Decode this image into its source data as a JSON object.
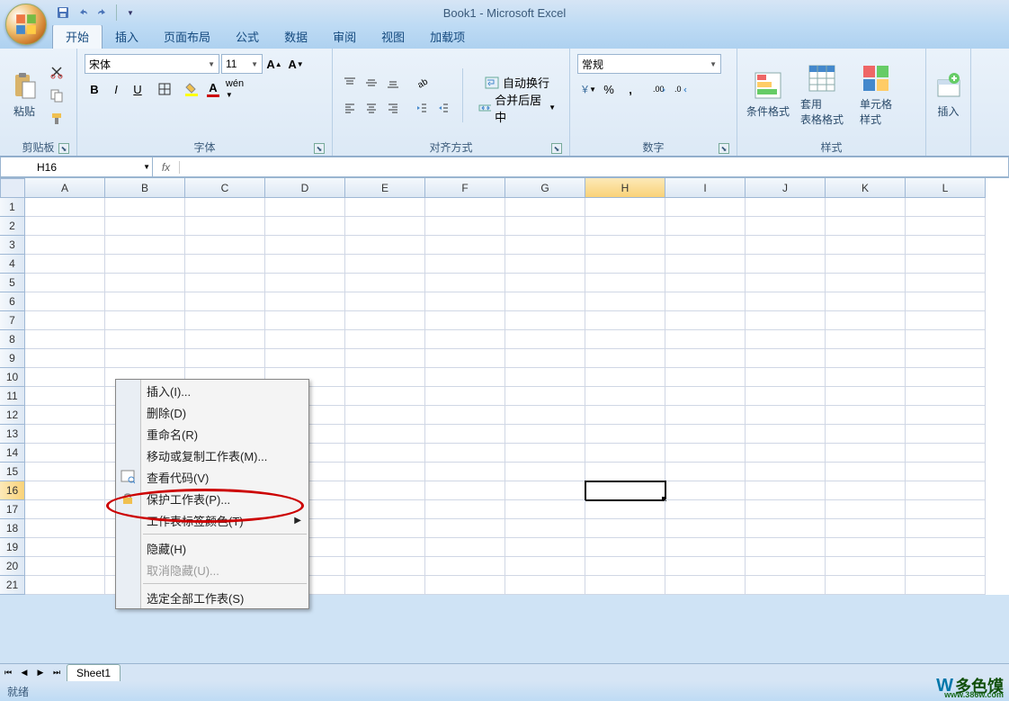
{
  "title": "Book1 - Microsoft Excel",
  "tabs": [
    "开始",
    "插入",
    "页面布局",
    "公式",
    "数据",
    "审阅",
    "视图",
    "加载项"
  ],
  "activeTab": 0,
  "clipboard": {
    "label": "剪贴板",
    "paste": "粘贴"
  },
  "font": {
    "label": "字体",
    "name": "宋体",
    "size": "11",
    "bold": "B",
    "italic": "I",
    "underline": "U"
  },
  "alignment": {
    "label": "对齐方式",
    "wrap": "自动换行",
    "merge": "合并后居中"
  },
  "number": {
    "label": "数字",
    "format": "常规",
    "percent": "%"
  },
  "styles": {
    "label": "样式",
    "cond": "条件格式",
    "table": "套用\n表格格式",
    "cell": "单元格\n样式"
  },
  "cells": {
    "insert": "插入"
  },
  "nameBox": "H16",
  "columns": [
    "A",
    "B",
    "C",
    "D",
    "E",
    "F",
    "G",
    "H",
    "I",
    "J",
    "K",
    "L"
  ],
  "rowCount": 21,
  "selectedCol": "H",
  "selectedRow": 16,
  "contextMenu": {
    "insert": "插入(I)...",
    "delete": "删除(D)",
    "rename": "重命名(R)",
    "move": "移动或复制工作表(M)...",
    "viewCode": "查看代码(V)",
    "protect": "保护工作表(P)...",
    "tabColor": "工作表标签颜色(T)",
    "hide": "隐藏(H)",
    "unhide": "取消隐藏(U)...",
    "selectAll": "选定全部工作表(S)"
  },
  "sheetTab": "Sheet1",
  "status": "就绪",
  "watermark": {
    "text": "多色馍",
    "url": "www.386w.com"
  }
}
